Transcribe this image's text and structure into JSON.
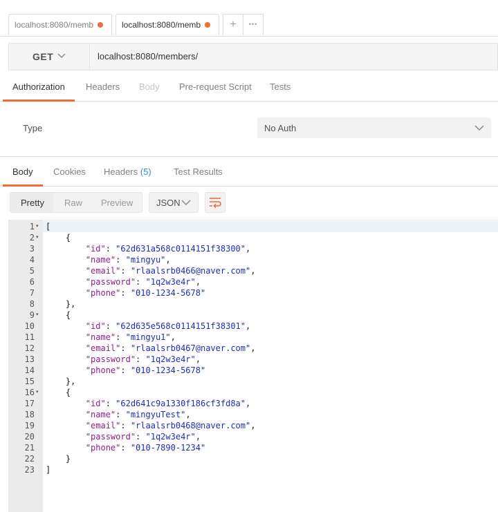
{
  "request_tabs": [
    {
      "label": "localhost:8080/memb",
      "unsaved_color": "#f26b3a"
    },
    {
      "label": "localhost:8080/memb",
      "unsaved_color": "#f26b3a"
    }
  ],
  "tab_actions": {
    "add_icon": "plus-icon",
    "more_icon": "ellipsis-icon",
    "add_glyph": "+",
    "more_glyph": "•••"
  },
  "request": {
    "method": "GET",
    "url": "localhost:8080/members/"
  },
  "request_tabs_section": [
    {
      "label": "Authorization",
      "state": "active"
    },
    {
      "label": "Headers",
      "state": "normal"
    },
    {
      "label": "Body",
      "state": "disabled"
    },
    {
      "label": "Pre-request Script",
      "state": "normal"
    },
    {
      "label": "Tests",
      "state": "normal"
    }
  ],
  "auth": {
    "type_label": "Type",
    "type_value": "No Auth"
  },
  "response_tabs": [
    {
      "label": "Body",
      "state": "active"
    },
    {
      "label": "Cookies",
      "state": "normal"
    },
    {
      "label": "Headers",
      "count": "(5)",
      "state": "normal"
    },
    {
      "label": "Test Results",
      "state": "normal"
    }
  ],
  "view_modes": [
    "Pretty",
    "Raw",
    "Preview"
  ],
  "format": "JSON",
  "accent_color": "#f26b3a",
  "code_lines": [
    {
      "n": "1",
      "fold": true,
      "parts": [
        [
          "p",
          "["
        ]
      ]
    },
    {
      "n": "2",
      "fold": true,
      "parts": [
        [
          "p",
          "    {"
        ]
      ]
    },
    {
      "n": "3",
      "fold": false,
      "parts": [
        [
          "p",
          "        "
        ],
        [
          "k",
          "\"id\""
        ],
        [
          "p",
          ": "
        ],
        [
          "s",
          "\"62d631a568c0114151f38300\""
        ],
        [
          "p",
          ","
        ]
      ]
    },
    {
      "n": "4",
      "fold": false,
      "parts": [
        [
          "p",
          "        "
        ],
        [
          "k",
          "\"name\""
        ],
        [
          "p",
          ": "
        ],
        [
          "s",
          "\"mingyu\""
        ],
        [
          "p",
          ","
        ]
      ]
    },
    {
      "n": "5",
      "fold": false,
      "parts": [
        [
          "p",
          "        "
        ],
        [
          "k",
          "\"email\""
        ],
        [
          "p",
          ": "
        ],
        [
          "s",
          "\"rlaalsrb0466@naver.com\""
        ],
        [
          "p",
          ","
        ]
      ]
    },
    {
      "n": "6",
      "fold": false,
      "parts": [
        [
          "p",
          "        "
        ],
        [
          "k",
          "\"password\""
        ],
        [
          "p",
          ": "
        ],
        [
          "s",
          "\"1q2w3e4r\""
        ],
        [
          "p",
          ","
        ]
      ]
    },
    {
      "n": "7",
      "fold": false,
      "parts": [
        [
          "p",
          "        "
        ],
        [
          "k",
          "\"phone\""
        ],
        [
          "p",
          ": "
        ],
        [
          "s",
          "\"010-1234-5678\""
        ]
      ]
    },
    {
      "n": "8",
      "fold": false,
      "parts": [
        [
          "p",
          "    },"
        ]
      ]
    },
    {
      "n": "9",
      "fold": true,
      "parts": [
        [
          "p",
          "    {"
        ]
      ]
    },
    {
      "n": "10",
      "fold": false,
      "parts": [
        [
          "p",
          "        "
        ],
        [
          "k",
          "\"id\""
        ],
        [
          "p",
          ": "
        ],
        [
          "s",
          "\"62d635e568c0114151f38301\""
        ],
        [
          "p",
          ","
        ]
      ]
    },
    {
      "n": "11",
      "fold": false,
      "parts": [
        [
          "p",
          "        "
        ],
        [
          "k",
          "\"name\""
        ],
        [
          "p",
          ": "
        ],
        [
          "s",
          "\"mingyu1\""
        ],
        [
          "p",
          ","
        ]
      ]
    },
    {
      "n": "12",
      "fold": false,
      "parts": [
        [
          "p",
          "        "
        ],
        [
          "k",
          "\"email\""
        ],
        [
          "p",
          ": "
        ],
        [
          "s",
          "\"rlaalsrb0467@naver.com\""
        ],
        [
          "p",
          ","
        ]
      ]
    },
    {
      "n": "13",
      "fold": false,
      "parts": [
        [
          "p",
          "        "
        ],
        [
          "k",
          "\"password\""
        ],
        [
          "p",
          ": "
        ],
        [
          "s",
          "\"1q2w3e4r\""
        ],
        [
          "p",
          ","
        ]
      ]
    },
    {
      "n": "14",
      "fold": false,
      "parts": [
        [
          "p",
          "        "
        ],
        [
          "k",
          "\"phone\""
        ],
        [
          "p",
          ": "
        ],
        [
          "s",
          "\"010-1234-5678\""
        ]
      ]
    },
    {
      "n": "15",
      "fold": false,
      "parts": [
        [
          "p",
          "    },"
        ]
      ]
    },
    {
      "n": "16",
      "fold": true,
      "parts": [
        [
          "p",
          "    {"
        ]
      ]
    },
    {
      "n": "17",
      "fold": false,
      "parts": [
        [
          "p",
          "        "
        ],
        [
          "k",
          "\"id\""
        ],
        [
          "p",
          ": "
        ],
        [
          "s",
          "\"62d641c9a1330f186cf3fd8a\""
        ],
        [
          "p",
          ","
        ]
      ]
    },
    {
      "n": "18",
      "fold": false,
      "parts": [
        [
          "p",
          "        "
        ],
        [
          "k",
          "\"name\""
        ],
        [
          "p",
          ": "
        ],
        [
          "s",
          "\"mingyuTest\""
        ],
        [
          "p",
          ","
        ]
      ]
    },
    {
      "n": "19",
      "fold": false,
      "parts": [
        [
          "p",
          "        "
        ],
        [
          "k",
          "\"email\""
        ],
        [
          "p",
          ": "
        ],
        [
          "s",
          "\"rlaalsrb0468@naver.com\""
        ],
        [
          "p",
          ","
        ]
      ]
    },
    {
      "n": "20",
      "fold": false,
      "parts": [
        [
          "p",
          "        "
        ],
        [
          "k",
          "\"password\""
        ],
        [
          "p",
          ": "
        ],
        [
          "s",
          "\"1q2w3e4r\""
        ],
        [
          "p",
          ","
        ]
      ]
    },
    {
      "n": "21",
      "fold": false,
      "parts": [
        [
          "p",
          "        "
        ],
        [
          "k",
          "\"phone\""
        ],
        [
          "p",
          ": "
        ],
        [
          "s",
          "\"010-7890-1234\""
        ]
      ]
    },
    {
      "n": "22",
      "fold": false,
      "parts": [
        [
          "p",
          "    }"
        ]
      ]
    },
    {
      "n": "23",
      "fold": false,
      "parts": [
        [
          "p",
          "]"
        ]
      ]
    }
  ]
}
